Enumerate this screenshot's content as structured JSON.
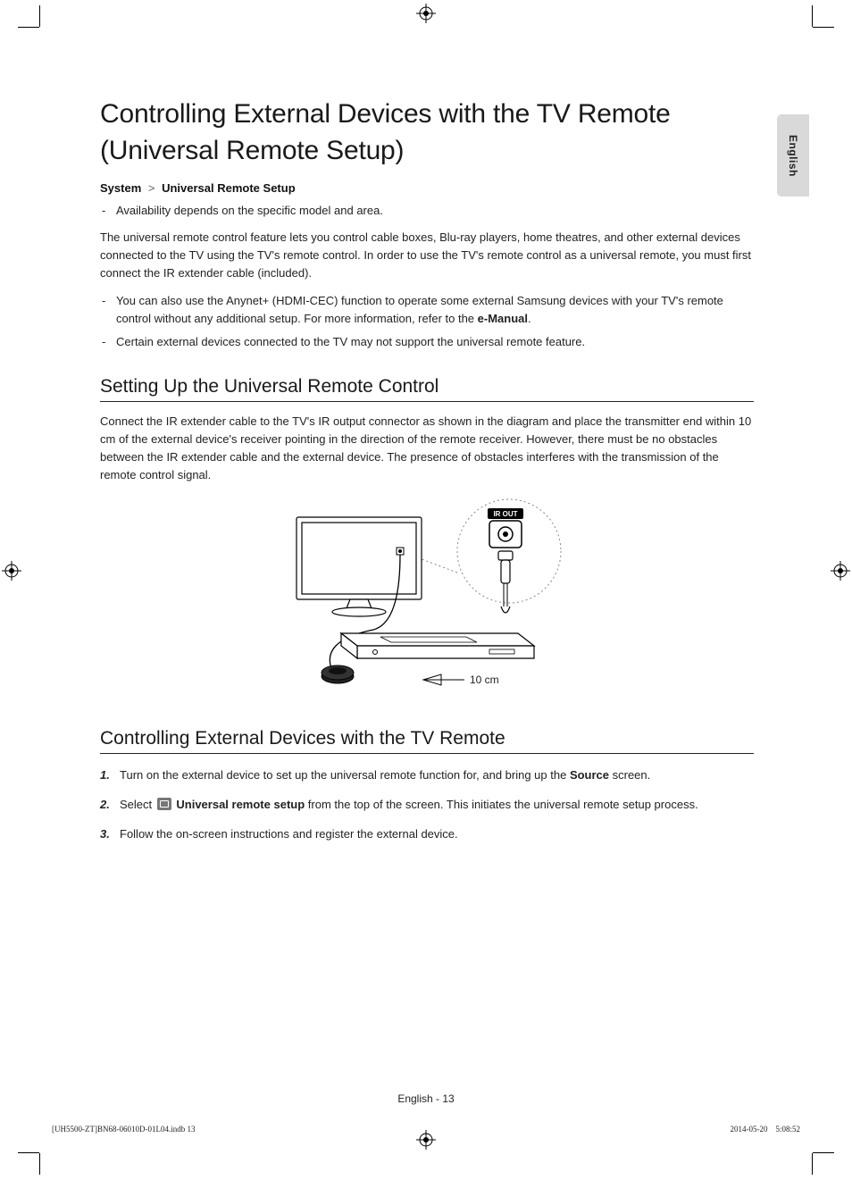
{
  "lang_tab": "English",
  "title": "Controlling External Devices with the TV Remote (Universal Remote Setup)",
  "breadcrumb": {
    "a": "System",
    "sep": ">",
    "b": "Universal Remote Setup"
  },
  "intro_bullets": [
    "Availability depends on the specific model and area."
  ],
  "intro_para": "The universal remote control feature lets you control cable boxes, Blu-ray players, home theatres, and other external devices connected to the TV using the TV's remote control. In order to use the TV's remote control as a universal remote, you must first connect the IR extender cable (included).",
  "intro_bullets2_pre": "You can also use the Anynet+ (HDMI-CEC) function to operate some external Samsung devices with your TV's remote control without any additional setup. For more information, refer to the ",
  "intro_bullets2_bold": "e-Manual",
  "intro_bullets2_post": ".",
  "intro_bullets3": "Certain external devices connected to the TV may not support the universal remote feature.",
  "h2a": "Setting Up the Universal Remote Control",
  "para2": "Connect the IR extender cable to the TV's IR output connector as shown in the diagram and place the transmitter end within 10 cm of the external device's receiver pointing in the direction of the remote receiver. However, there must be no obstacles between the IR extender cable and the external device. The presence of obstacles interferes with the transmission of the remote control signal.",
  "diagram": {
    "ir_out_label": "IR OUT",
    "distance_label": "10 cm"
  },
  "h2b": "Controlling External Devices with the TV Remote",
  "steps": {
    "s1": {
      "num": "1.",
      "pre": "Turn on the external device to set up the universal remote function for, and bring up the ",
      "bold": "Source",
      "post": " screen."
    },
    "s2": {
      "num": "2.",
      "pre": "Select ",
      "bold": "Universal remote setup",
      "post": " from the top of the screen. This initiates the universal remote setup process."
    },
    "s3": {
      "num": "3.",
      "text": "Follow the on-screen instructions and register the external device."
    }
  },
  "footer_center": "English - 13",
  "footer_left": "[UH5500-ZT]BN68-06010D-01L04.indb   13",
  "footer_right": "2014-05-20     5:08:52"
}
